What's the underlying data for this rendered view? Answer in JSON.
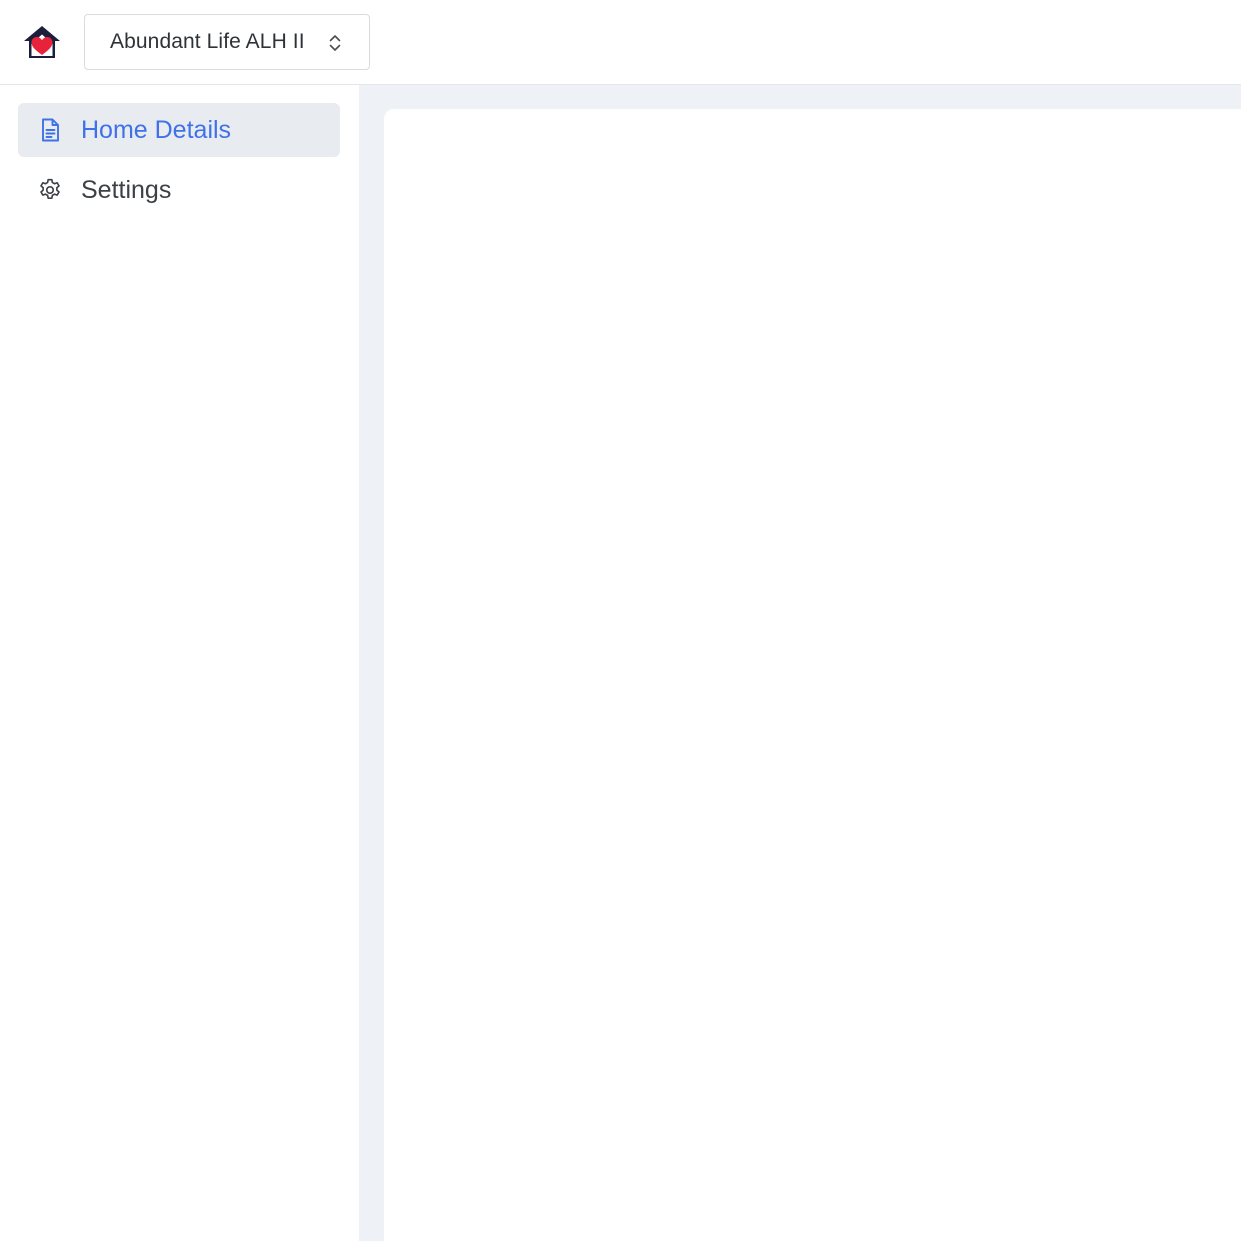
{
  "header": {
    "logo_icon": "house-heart-icon",
    "home_selector": {
      "selected_value": "Abundant Life ALH II",
      "icon": "chevron-updown-icon"
    }
  },
  "sidebar": {
    "items": [
      {
        "label": "Home Details",
        "icon": "document-icon",
        "active": true
      },
      {
        "label": "Settings",
        "icon": "gear-icon",
        "active": false
      }
    ]
  },
  "colors": {
    "accent": "#3f72e8",
    "logo_roof": "#1b1f3b",
    "logo_heart": "#e8223a",
    "active_bg": "#e8ebf0",
    "main_bg": "#eef1f5",
    "text": "#3d4146"
  }
}
